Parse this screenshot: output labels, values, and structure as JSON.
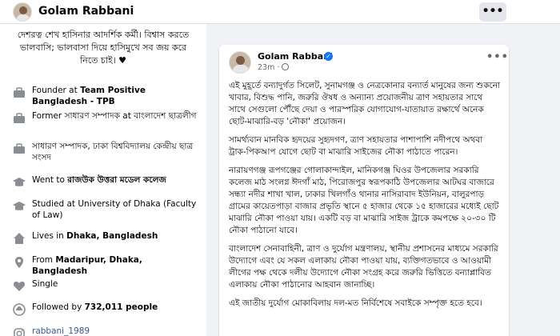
{
  "profile": {
    "name": "Golam Rabbani",
    "more_glyph": "•••"
  },
  "intro": {
    "bio": "দেশরত্ন শেখ হাসিনার আদর্শিক কর্মী। বিশ্বাস করতে ভালবাসি; ভালবাসা দিয়ে হাসিমুখে সব জয় করে নিতে চাই। ♥",
    "items": [
      {
        "icon": "briefcase-icon",
        "prefix": "Founder at ",
        "bold": "Team Positive Bangladesh - TPB"
      },
      {
        "icon": "briefcase-icon",
        "prefix": "Former সাধারণ সম্পাদক at বাংলাদেশ ছাত্রলীগ",
        "bold": ""
      },
      {
        "icon": "briefcase-icon",
        "prefix": "সাধারণ সম্পাদক, ঢাকা বিশ্ববিদ্যালয় কেন্দ্রীয় ছাত্র সংসদ",
        "bold": ""
      },
      {
        "icon": "graduation-cap-icon",
        "prefix": "Went to ",
        "bold": "রাজউক উত্তরা মডেল কলেজ"
      },
      {
        "icon": "graduation-cap-icon",
        "prefix": "Studied at University of Dhaka (Faculty of Law)",
        "bold": ""
      },
      {
        "icon": "home-icon",
        "prefix": "Lives in ",
        "bold": "Dhaka, Bangladesh"
      },
      {
        "icon": "location-pin-icon",
        "prefix": "From ",
        "bold": "Madaripur, Dhaka, Bangladesh"
      },
      {
        "icon": "heart-icon",
        "prefix": "Single",
        "bold": ""
      },
      {
        "icon": "followers-icon",
        "prefix": "Followed by ",
        "bold": "732,011 people"
      }
    ],
    "instagram": "rabbani_1989"
  },
  "post": {
    "author": "Golam Rabbani",
    "time": "23m",
    "meta_sep": "·",
    "more_glyph": "•••",
    "paragraphs": [
      "এই মুহূর্তে বন্যাদুর্গত সিলেট, সুনামগঞ্জ ও নেত্রকোনার বন্যার্ত মানুষের জন্য শুকনো খাবার, বিশুদ্ধ পানি, জরুরি ঔষধ ও অন্যান্য প্রয়োজনীয় ত্রাণ সহায়তার সাথে সাথে সেগুলো পৌঁছে দেয়া ও পারস্পরিক যোগাযোগ-যাতায়াত রক্ষার্থে অনেক ছোট-মাঝারি-বড় 'নৌকা' প্রয়োজন।",
      "সামর্থ্যবান মানবিক হৃদয়ের সুহৃদগণ, ত্রাণ সহায়তার পাশাপাশি নদীপথে অথবা ট্রাক-পিকআপ যোগে ছোট বা মাঝারি সাইজের নৌকা পাঠাতে পারেন।",
      "নারায়ণগঞ্জ রূপগঞ্জের গোলাকান্দাইল, মানিকগঞ্জ ঘিওর উপজেলার সরকারি কলেজ মাঠ সংলগ্ন ঈদগাঁ মাঠ, পিরোজপুর স্বরূপকাঠি উপজেলার আটঘর বাজারে সন্ধ্যা নদীর শাখা খাল, ঢাকার খিলগাঁও থানার নাসিরাবাদ ইউনিয়ন, বালুরপাড় গ্রামের কায়েতপাড়া বাজার প্রভৃতি স্থানে ৫ হাজার থেকে ১৫ হাজারের মধ্যেই ছোট মাঝারি নৌকা পাওয়া যায়। একটি বড় বা মাঝারি সাইজ ট্রাকে কমপক্ষে ২০-৩০ টি নৌকা পাঠানো যাবে।",
      "বাংলাদেশ সেনাবাহিনী, ত্রাণ ও দুর্যোগ মন্ত্রণালয়, স্থানীয় প্রশাসনের মাধ্যমে সরকারি উদ্যোগে এবং যে সকল এলাকায় নৌকা পাওয়া যায়, ব্যক্তিগতভাবে ও আওয়ামী লীগের পক্ষ থেকে দলীয় উদ্যোগে নৌকা সংগ্রহ করে জরুরি ভিত্তিতে বন্যাপ্লাবিত এলাকায় নৌকা পাঠানোর আহবান জানাচ্ছি।",
      "এই জাতীয় দুর্যোগ মোকাবিলায় দল-মত নির্বিশেষে সবাইকে সম্পৃক্ত হতে হবে।"
    ]
  }
}
